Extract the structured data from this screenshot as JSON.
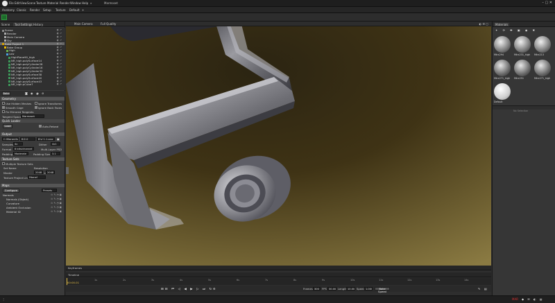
{
  "menubar": {
    "items": [
      "File",
      "Edit",
      "View",
      "Scene",
      "Texture",
      "Material",
      "Render",
      "Window",
      "Help"
    ],
    "more": "»",
    "title": "Marmoset",
    "winctrls": "– ▢ ✕"
  },
  "tabs": {
    "items": [
      "Anatomy",
      "Classic",
      "Render",
      "Setup",
      "Texture",
      "Default"
    ],
    "add": "+"
  },
  "left": {
    "tabs": [
      "Scene",
      "Tool Settings",
      "History"
    ],
    "tree": [
      {
        "label": "Scene",
        "color": "#888",
        "indent": 1
      },
      {
        "label": "Render",
        "color": "#aaa",
        "indent": 2
      },
      {
        "label": "Main Camera",
        "color": "#aaa",
        "indent": 2
      },
      {
        "label": "Sky",
        "color": "#aaa",
        "indent": 2
      },
      {
        "label": "Bake Project 1",
        "color": "#d8a000",
        "indent": 1,
        "sel": true
      },
      {
        "label": "Bake Group",
        "color": "#e8b800",
        "indent": 2
      },
      {
        "label": "High",
        "color": "#6ab04c",
        "indent": 3
      },
      {
        "label": "Low",
        "color": "#4aa0e0",
        "indent": 3
      },
      {
        "label": "HighPlane90_high",
        "color": "#3c9a5a",
        "indent": 4
      },
      {
        "label": "NR_high.polySurface14",
        "color": "#3c9a5a",
        "indent": 4
      },
      {
        "label": "NR_high.polyCylinder28",
        "color": "#3c9a5a",
        "indent": 4
      },
      {
        "label": "NR_high.polyCylinder16",
        "color": "#3c9a5a",
        "indent": 4
      },
      {
        "label": "NR_high.polyCylinder32",
        "color": "#3c9a5a",
        "indent": 4
      },
      {
        "label": "NR_high.polySurface38",
        "color": "#3c9a5a",
        "indent": 4
      },
      {
        "label": "NR_high.polySurface40",
        "color": "#3c9a5a",
        "indent": 4
      },
      {
        "label": "NR_high.polySurface43",
        "color": "#3c9a5a",
        "indent": 4
      },
      {
        "label": "NR_high.pCube7",
        "color": "#3c9a5a",
        "indent": 4
      }
    ],
    "bake_btn": "Bake",
    "geometry": {
      "title": "Geometry",
      "use_hidden": "Use Hidden Meshes",
      "ignore_transforms": "Ignore Transforms",
      "smooth_cage": "Smooth Cage",
      "ignore_backfaces": "Ignore Back Faces",
      "fix_mirrored": "Fix Mirrored Tangents",
      "tangent_label": "Tangent Space",
      "tangent_value": "Marmoset",
      "quick_loader": "Quick Loader",
      "load_btn": "Load",
      "auto_reload": "Auto-Reload"
    },
    "output": {
      "title": "Output",
      "path": "C:/Marps/4x",
      "path2": "B/2.0",
      "path3": "B's/ 1.1.png",
      "samples_label": "Samples",
      "samples_value": "4x",
      "dither_label": "Dither",
      "dither_value": "4x1",
      "format_label": "Format",
      "format_value": "8 bits/channel",
      "multi_psd": "Multi-Layer PSD",
      "padding_label": "Padding",
      "padding_value": "Moderate",
      "padsize_label": "Padding Size",
      "padsize_value": "3.1"
    },
    "texture_sets": {
      "title": "Texture Sets",
      "multiple": "Multiple Texture Sets",
      "set_name": "Set Name",
      "resolution": "Resolution",
      "master_label": "Master",
      "res_w": "2048",
      "res_h": "2048",
      "project_link_label": "Texture Project Link",
      "project_link_value": "[None]"
    },
    "maps": {
      "title": "Maps",
      "configure": "Configure",
      "presets": "Presets",
      "items": [
        "Normals",
        "Normals (Object)",
        "Curvature",
        "Ambient Occlusion",
        "Material ID"
      ]
    }
  },
  "viewport": {
    "camera": "Main Camera",
    "quality": "Full Quality",
    "icons": "◐ ☰ ▢"
  },
  "right": {
    "tab": "Materials",
    "toolbar": "✦ ⟳ ✚ ▣ ◉ ✖",
    "materials": [
      "Mtrx294",
      "Mtrx231_high",
      "Mtrx213",
      "Mtrx271_high",
      "Mtrx251",
      "Mtrx271_high",
      "Default"
    ],
    "no_select": "No Selection"
  },
  "timeline": {
    "hotframe": "Keyframes",
    "label": "Timeline",
    "frame_marker": "00:00.01",
    "ticks": [
      "0",
      "1s",
      "2s",
      "3s",
      "4s",
      "5s",
      "6s",
      "7s",
      "8s",
      "9s",
      "10s",
      "11s",
      "12s",
      "13s",
      "14s"
    ],
    "frames_label": "Frames",
    "frames_value": "300",
    "fps_label": "FPS",
    "fps_value": "30.000",
    "length_label": "Length",
    "length_value": "10.000",
    "speed_label": "Speed",
    "speed_value": "1.000",
    "bake_speed": "Bake Speed"
  },
  "status": {
    "text": "MAR"
  }
}
